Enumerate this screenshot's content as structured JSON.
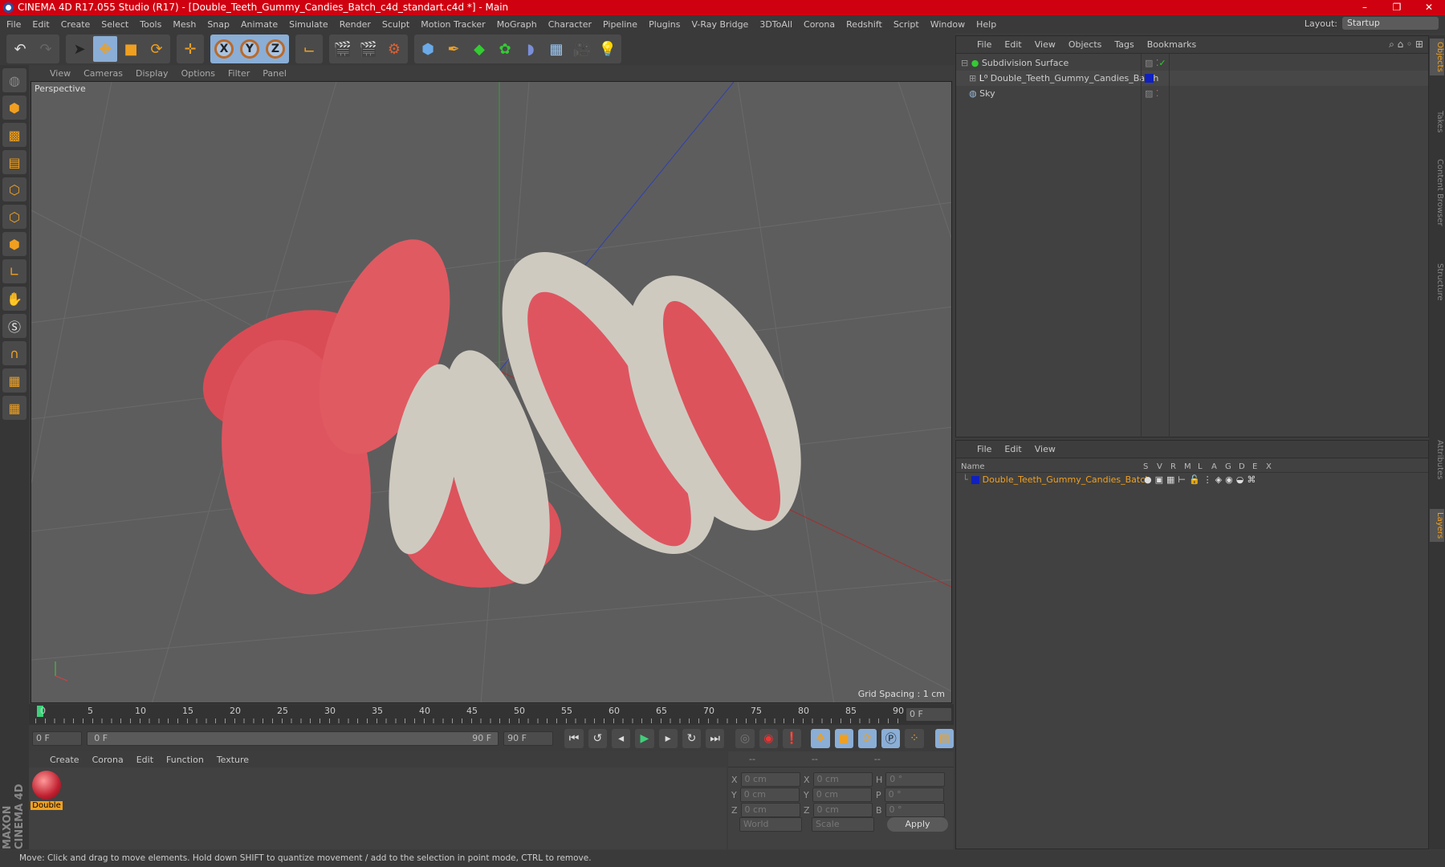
{
  "window": {
    "title": "CINEMA 4D R17.055 Studio (R17) - [Double_Teeth_Gummy_Candies_Batch_c4d_standart.c4d *] - Main",
    "minimize": "–",
    "maximize": "❐",
    "close": "✕"
  },
  "menubar": [
    "File",
    "Edit",
    "Create",
    "Select",
    "Tools",
    "Mesh",
    "Snap",
    "Animate",
    "Simulate",
    "Render",
    "Sculpt",
    "Motion Tracker",
    "MoGraph",
    "Character",
    "Pipeline",
    "Plugins",
    "V-Ray Bridge",
    "3DToAll",
    "Corona",
    "Redshift",
    "Script",
    "Window",
    "Help"
  ],
  "layout": {
    "label": "Layout:",
    "value": "Startup"
  },
  "toolbar": {
    "icons": [
      "undo-icon",
      "redo-icon",
      "select-icon",
      "move-icon",
      "scale-icon",
      "rotate-icon",
      "transform-icon",
      "x-axis-icon",
      "y-axis-icon",
      "z-axis-icon",
      "coordinate-system-icon",
      "render-view-icon",
      "render-picture-viewer-icon",
      "render-settings-icon",
      "cube-icon",
      "pen-icon",
      "subdivision-icon",
      "cloner-icon",
      "deformer-icon",
      "floor-icon",
      "camera-icon",
      "light-icon"
    ],
    "axis_labels": [
      "X",
      "Y",
      "Z"
    ]
  },
  "viewport": {
    "menu": [
      "View",
      "Cameras",
      "Display",
      "Options",
      "Filter",
      "Panel"
    ],
    "label": "Perspective",
    "grid_spacing": "Grid Spacing : 1 cm"
  },
  "timeline": {
    "ticks": [
      "0",
      "5",
      "10",
      "15",
      "20",
      "25",
      "30",
      "35",
      "40",
      "45",
      "50",
      "55",
      "60",
      "65",
      "70",
      "75",
      "80",
      "85",
      "90"
    ],
    "current_frame": "0 F",
    "start": "0 F",
    "range_start": "0 F",
    "range_end": "90 F",
    "end": "90 F"
  },
  "materials": {
    "menu": [
      "Create",
      "Corona",
      "Edit",
      "Function",
      "Texture"
    ],
    "items": [
      {
        "name": "Double"
      }
    ]
  },
  "coordinates": {
    "headers": [
      "--",
      "--",
      "--"
    ],
    "rows": [
      {
        "a": "X",
        "av": "0 cm",
        "b": "X",
        "bv": "0 cm",
        "c": "H",
        "cv": "0 °"
      },
      {
        "a": "Y",
        "av": "0 cm",
        "b": "Y",
        "bv": "0 cm",
        "c": "P",
        "cv": "0 °"
      },
      {
        "a": "Z",
        "av": "0 cm",
        "b": "Z",
        "bv": "0 cm",
        "c": "B",
        "cv": "0 °"
      }
    ],
    "world": "World",
    "scale": "Scale",
    "apply": "Apply"
  },
  "object_manager": {
    "menu": [
      "File",
      "Edit",
      "View",
      "Objects",
      "Tags",
      "Bookmarks"
    ],
    "objects": [
      {
        "name": "Subdivision Surface"
      },
      {
        "name": "Double_Teeth_Gummy_Candies_Batch"
      },
      {
        "name": "Sky"
      }
    ]
  },
  "layers": {
    "menu": [
      "File",
      "Edit",
      "View"
    ],
    "columns": [
      "Name",
      "S",
      "V",
      "R",
      "M",
      "L",
      "A",
      "G",
      "D",
      "E",
      "X"
    ],
    "rows": [
      {
        "name": "Double_Teeth_Gummy_Candies_Batch",
        "color": "#1020c0"
      }
    ]
  },
  "side_tabs": [
    "Objects",
    "Takes",
    "Content Browser",
    "Structure",
    "Attributes",
    "Layers"
  ],
  "brand": "MAXON CINEMA 4D",
  "status": "Move: Click and drag to move elements. Hold down SHIFT to quantize movement / add to the selection in point mode, CTRL to remove.",
  "colors": {
    "title": "#cf0010",
    "accent": "#f0a020",
    "highlight": "#8aaed6",
    "candy_red": "#e0545c",
    "candy_white": "#cfcac0"
  }
}
